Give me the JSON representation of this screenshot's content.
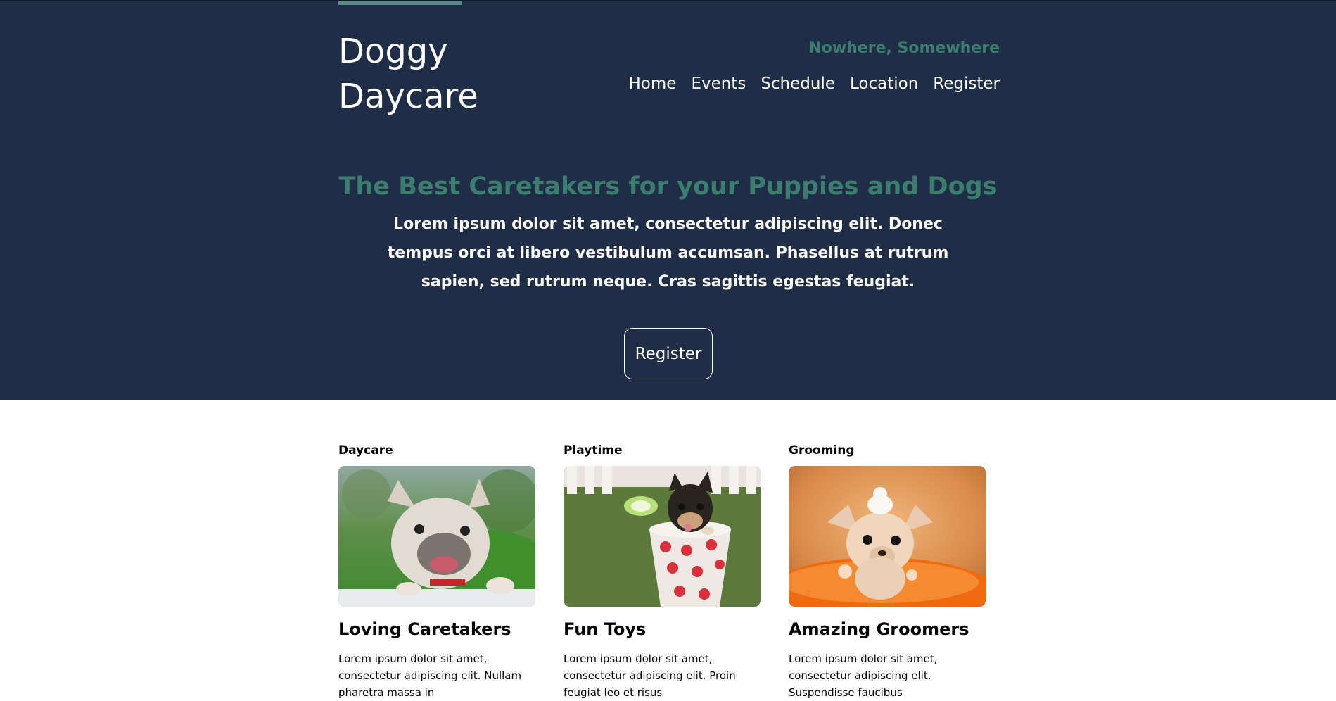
{
  "header": {
    "brand_line1": "Doggy",
    "brand_line2": "Daycare",
    "location": "Nowhere, Somewhere",
    "nav": [
      "Home",
      "Events",
      "Schedule",
      "Location",
      "Register"
    ]
  },
  "hero": {
    "title": "The Best Caretakers for your Puppies and Dogs",
    "text": "Lorem ipsum dolor sit amet, consectetur adipiscing elit. Donec tempus orci at libero vestibulum accumsan. Phasellus at rutrum sapien, sed rutrum neque. Cras sagittis egestas feugiat.",
    "button": "Register"
  },
  "cards": [
    {
      "label": "Daycare",
      "image_icon": "french-bulldog-photo",
      "title": "Loving Caretakers",
      "text": "Lorem ipsum dolor sit amet, consectetur adipiscing elit. Nullam pharetra massa in"
    },
    {
      "label": "Playtime",
      "image_icon": "puppy-in-cup-photo",
      "title": "Fun Toys",
      "text": "Lorem ipsum dolor sit amet, consectetur adipiscing elit. Proin feugiat leo et risus"
    },
    {
      "label": "Grooming",
      "image_icon": "chihuahua-bath-photo",
      "title": "Amazing Groomers",
      "text": "Lorem ipsum dolor sit amet, consectetur adipiscing elit. Suspendisse faucibus"
    }
  ],
  "colors": {
    "hero_bg": "#1f2d47",
    "accent": "#3b7d6e",
    "accent_bar": "#5a8a82",
    "text_light": "#ffffff"
  }
}
